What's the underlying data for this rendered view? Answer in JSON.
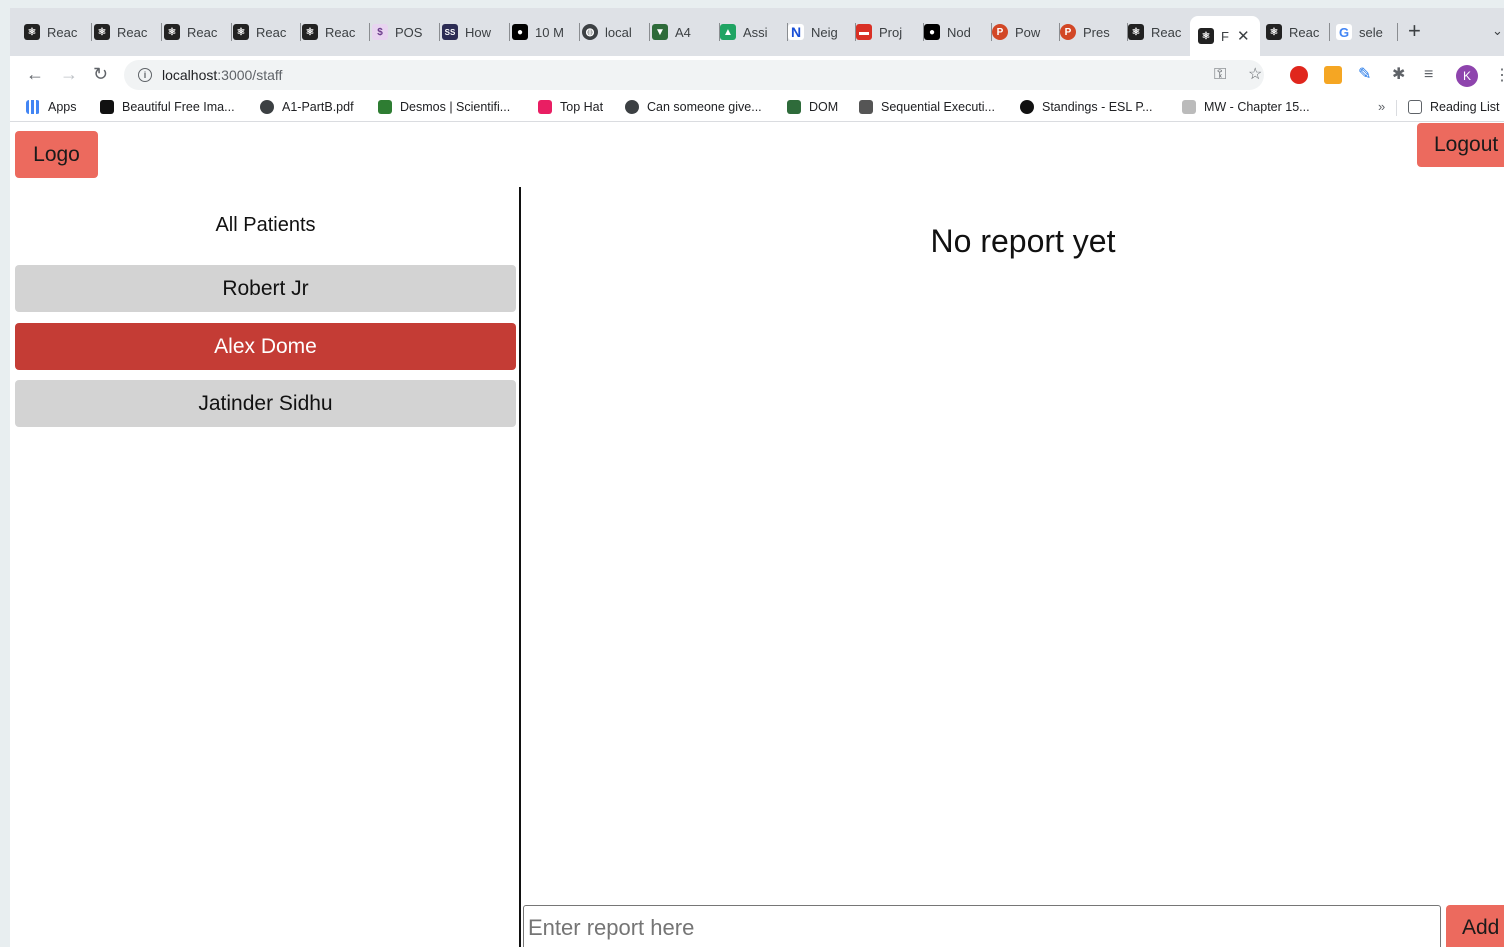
{
  "browser": {
    "tabs": [
      {
        "label": "Reac",
        "icon": "react-icon",
        "color": "#222222"
      },
      {
        "label": "Reac",
        "icon": "react-icon",
        "color": "#222222"
      },
      {
        "label": "Reac",
        "icon": "react-icon",
        "color": "#222222"
      },
      {
        "label": "Reac",
        "icon": "react-icon",
        "color": "#222222"
      },
      {
        "label": "Reac",
        "icon": "react-icon",
        "color": "#222222"
      },
      {
        "label": "POS",
        "icon": "postgres-icon",
        "color": "#e8d4f0"
      },
      {
        "label": "How",
        "icon": "ss-icon",
        "color": "#2c2c54"
      },
      {
        "label": "10 M",
        "icon": "medium-icon",
        "color": "#000000"
      },
      {
        "label": "local",
        "icon": "globe-icon",
        "color": "#3c4043"
      },
      {
        "label": "A4",
        "icon": "shield-icon",
        "color": "#2e6b3a"
      },
      {
        "label": "Assi",
        "icon": "google-drive-icon",
        "color": "#1fa463"
      },
      {
        "label": "Neig",
        "icon": "notion-n-icon",
        "color": "#1a4fd6"
      },
      {
        "label": "Proj",
        "icon": "printer-icon",
        "color": "#d93025"
      },
      {
        "label": "Nod",
        "icon": "medium-icon",
        "color": "#000000"
      },
      {
        "label": "Pow",
        "icon": "powerpoint-icon",
        "color": "#d24726"
      },
      {
        "label": "Pres",
        "icon": "powerpoint-icon",
        "color": "#d24726"
      },
      {
        "label": "Reac",
        "icon": "react-icon",
        "color": "#222222"
      },
      {
        "label": "F",
        "icon": "react-icon",
        "color": "#222222",
        "active": true
      },
      {
        "label": "Reac",
        "icon": "react-icon",
        "color": "#222222"
      },
      {
        "label": "sele",
        "icon": "google-icon",
        "color": "#4285f4"
      }
    ],
    "url_host": "localhost",
    "url_path": ":3000/staff",
    "bookmarks": [
      {
        "label": "Apps",
        "icon": "apps-grid-icon",
        "color": "#4285f4"
      },
      {
        "label": "Beautiful Free Ima...",
        "icon": "unsplash-icon",
        "color": "#111111"
      },
      {
        "label": "A1-PartB.pdf",
        "icon": "globe-icon",
        "color": "#3c4043"
      },
      {
        "label": "Desmos | Scientifi...",
        "icon": "desmos-icon",
        "color": "#2e7d32"
      },
      {
        "label": "Top Hat",
        "icon": "tophat-icon",
        "color": "#e91e63"
      },
      {
        "label": "Can someone give...",
        "icon": "globe-icon",
        "color": "#3c4043"
      },
      {
        "label": "DOM",
        "icon": "shield-icon",
        "color": "#2e6b3a"
      },
      {
        "label": "Sequential Executi...",
        "icon": "next-icon",
        "color": "#555555"
      },
      {
        "label": "Standings - ESL P...",
        "icon": "esl-icon",
        "color": "#111111"
      },
      {
        "label": "MW - Chapter 15...",
        "icon": "mw-icon",
        "color": "#777777"
      }
    ],
    "reading_list": "Reading List"
  },
  "app": {
    "logo_label": "Logo",
    "logout_label": "Logout",
    "sidebar_title": "All Patients",
    "patients": [
      {
        "name": "Robert Jr",
        "selected": false
      },
      {
        "name": "Alex Dome",
        "selected": true
      },
      {
        "name": "Jatinder Sidhu",
        "selected": false
      }
    ],
    "empty_message": "No report yet",
    "report_placeholder": "Enter report here",
    "add_label": "Add",
    "accent_color": "#ec6a5e",
    "selected_color": "#c43c35"
  }
}
